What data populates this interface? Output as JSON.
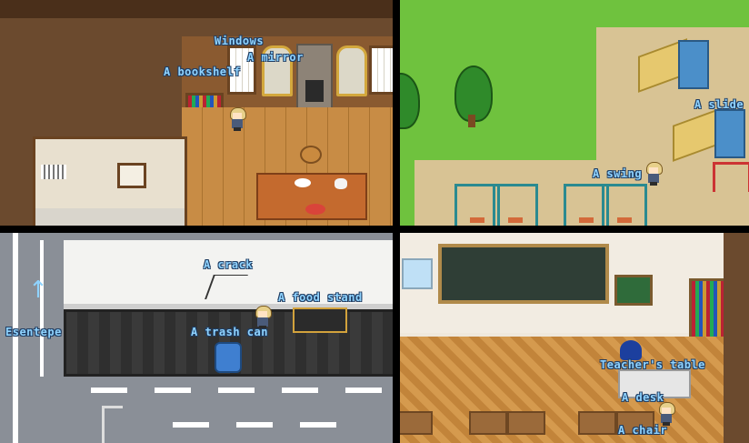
{
  "panels": {
    "house": {
      "labels": {
        "windows": "Windows",
        "mirror": "A mirror",
        "bookshelf": "A bookshelf"
      }
    },
    "playground": {
      "labels": {
        "slide": "A slide",
        "swing": "A swing"
      }
    },
    "street": {
      "labels": {
        "crack": "A crack",
        "food_stand": "A food stand",
        "trash_can": "A trash can",
        "street_name": "Esentepe"
      }
    },
    "classroom": {
      "labels": {
        "teachers_table": "Teacher's table",
        "desk": "A desk",
        "chair": "A chair"
      }
    }
  },
  "colors": {
    "label_text": "#8fd3ff",
    "label_outline": "#1f3d63",
    "divider": "#000000"
  },
  "icons": [
    "up-arrow-icon"
  ]
}
